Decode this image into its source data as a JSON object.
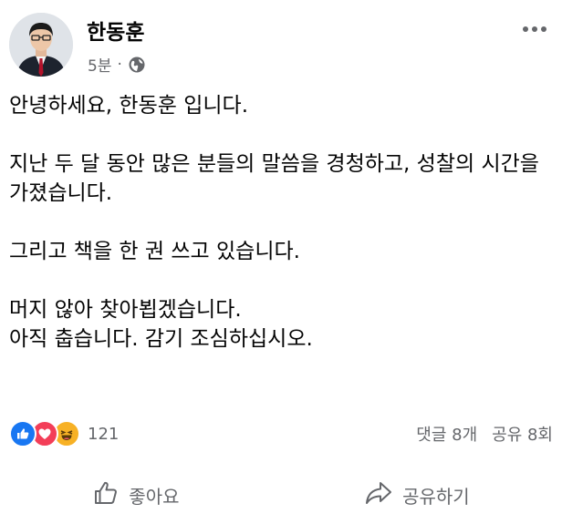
{
  "post": {
    "author": "한동훈",
    "time": "5분",
    "separator": "·",
    "privacy_icon": "globe-icon",
    "more_icon": "more-options-icon",
    "paragraphs": [
      "안녕하세요, 한동훈 입니다.",
      "지난 두 달 동안 많은 분들의 말씀을 경청하고, 성찰의 시간을 가졌습니다.",
      "그리고 책을 한 권 쓰고 있습니다.",
      "머지 않아 찾아뵙겠습니다.\n아직 춥습니다. 감기 조심하십시오."
    ]
  },
  "reactions": {
    "icons": [
      "like-icon",
      "love-icon",
      "haha-icon"
    ],
    "colors": {
      "like": "#1877f2",
      "love": "#f33e58",
      "haha": "#f7b125"
    },
    "count": "121"
  },
  "stats": {
    "comments": "댓글 8개",
    "shares": "공유 8회"
  },
  "actions": {
    "like_label": "좋아요",
    "share_label": "공유하기"
  }
}
